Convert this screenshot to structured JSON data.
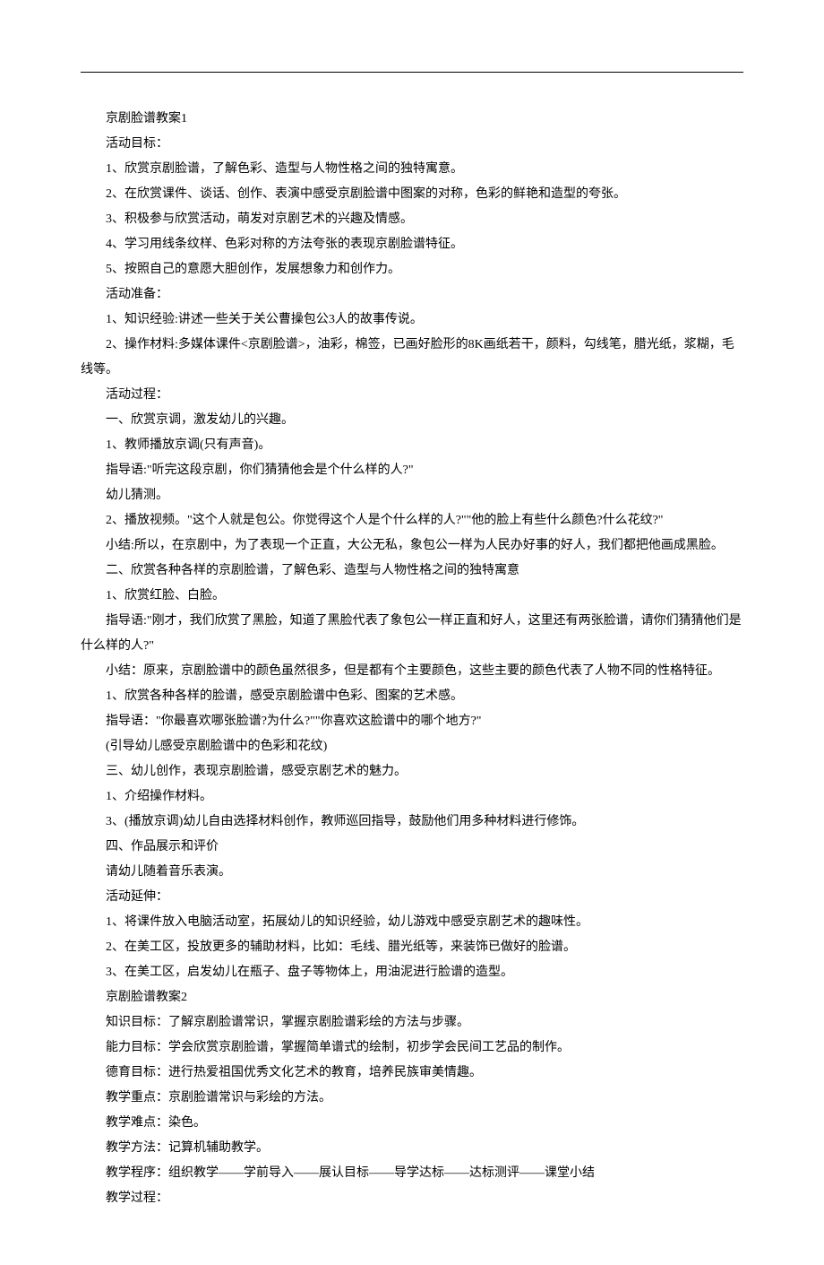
{
  "lines": [
    "京剧脸谱教案1",
    "活动目标：",
    "1、欣赏京剧脸谱，了解色彩、造型与人物性格之间的独特寓意。",
    "2、在欣赏课件、谈话、创作、表演中感受京剧脸谱中图案的对称，色彩的鲜艳和造型的夸张。",
    "3、积极参与欣赏活动，萌发对京剧艺术的兴趣及情感。",
    "4、学习用线条纹样、色彩对称的方法夸张的表现京剧脸谱特征。",
    "5、按照自己的意愿大胆创作，发展想象力和创作力。",
    "活动准备：",
    "1、知识经验:讲述一些关于关公曹操包公3人的故事传说。",
    "2、操作材料:多媒体课件<京剧脸谱>，油彩，棉签，已画好脸形的8K画纸若干，颜料，勾线笔，腊光纸，浆糊，毛线等。",
    "活动过程：",
    "一、欣赏京调，激发幼儿的兴趣。",
    "1、教师播放京调(只有声音)。",
    "指导语:\"听完这段京剧，你们猜猜他会是个什么样的人?\"",
    "幼儿猜测。",
    "2、播放视频。\"这个人就是包公。你觉得这个人是个什么样的人?\"\"他的脸上有些什么颜色?什么花纹?\"",
    "小结:所以，在京剧中，为了表现一个正直，大公无私，象包公一样为人民办好事的好人，我们都把他画成黑脸。",
    "二、欣赏各种各样的京剧脸谱，了解色彩、造型与人物性格之间的独特寓意",
    "1、欣赏红脸、白脸。",
    "指导语:\"刚才，我们欣赏了黑脸，知道了黑脸代表了象包公一样正直和好人，这里还有两张脸谱，请你们猜猜他们是什么样的人?\"",
    "小结：原来，京剧脸谱中的颜色虽然很多，但是都有个主要颜色，这些主要的颜色代表了人物不同的性格特征。",
    "1、欣赏各种各样的脸谱，感受京剧脸谱中色彩、图案的艺术感。",
    "指导语：\"你最喜欢哪张脸谱?为什么?\"\"你喜欢这脸谱中的哪个地方?\"",
    "(引导幼儿感受京剧脸谱中的色彩和花纹)",
    "三、幼儿创作，表现京剧脸谱，感受京剧艺术的魅力。",
    "1、介绍操作材料。",
    "3、(播放京调)幼儿自由选择材料创作，教师巡回指导，鼓励他们用多种材料进行修饰。",
    "四、作品展示和评价",
    "请幼儿随着音乐表演。",
    "活动延伸：",
    "1、将课件放入电脑活动室，拓展幼儿的知识经验，幼儿游戏中感受京剧艺术的趣味性。",
    "2、在美工区，投放更多的辅助材料，比如：毛线、腊光纸等，来装饰已做好的脸谱。",
    "3、在美工区，启发幼儿在瓶子、盘子等物体上，用油泥进行脸谱的造型。",
    "京剧脸谱教案2",
    "知识目标：了解京剧脸谱常识，掌握京剧脸谱彩绘的方法与步骤。",
    "能力目标：学会欣赏京剧脸谱，掌握简单谱式的绘制，初步学会民间工艺品的制作。",
    "德育目标：进行热爱祖国优秀文化艺术的教育，培养民族审美情趣。",
    "教学重点：京剧脸谱常识与彩绘的方法。",
    "教学难点：染色。",
    "教学方法：记算机辅助教学。",
    "教学程序：组织教学——学前导入——展认目标——导学达标——达标测评——课堂小结",
    "教学过程："
  ]
}
